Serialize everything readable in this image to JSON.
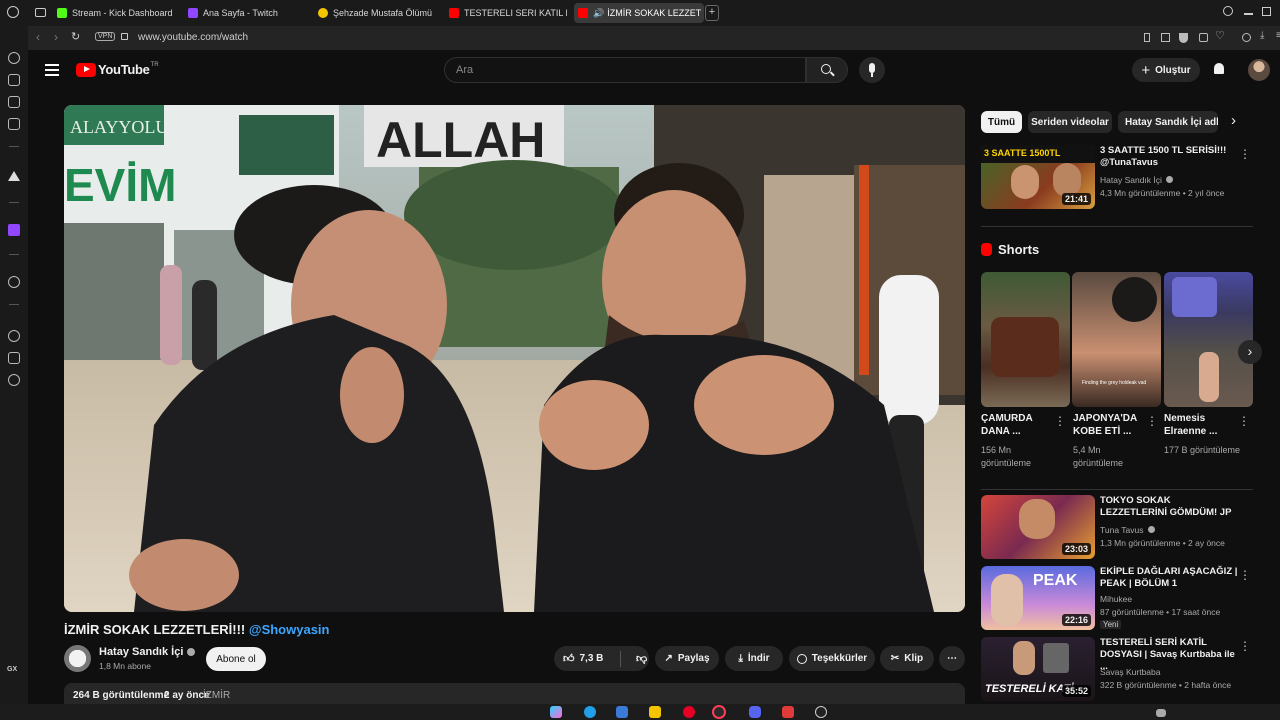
{
  "browser": {
    "tabs": [
      {
        "label": "Stream - Kick Dashboard",
        "color": "#53fc18"
      },
      {
        "label": "Ana Sayfa - Twitch",
        "color": "#9146ff"
      },
      {
        "label": "Şehzade Mustafa Ölümü",
        "color": "#f5c400"
      },
      {
        "label": "TESTERELI SERI KATIL D",
        "color": "#ff0000"
      },
      {
        "label": "İZMİR SOKAK LEZZET",
        "color": "#ff0000"
      }
    ],
    "vpn_label": "VPN",
    "url": "www.youtube.com/watch"
  },
  "header": {
    "logo_text": "YouTube",
    "logo_sup": "TR",
    "search_placeholder": "Ara",
    "create_label": "Oluştur"
  },
  "video": {
    "title": "İZMİR SOKAK LEZZETLERİ!!!",
    "title_tag": "@Showyasin",
    "channel": "Hatay Sandık İçi",
    "subscribers": "1,8 Mn abone",
    "subscribe_label": "Abone ol",
    "likes": "7,3 B",
    "share_label": "Paylaş",
    "download_label": "İndir",
    "thanks_label": "Teşekkürler",
    "clip_label": "Klip",
    "views": "264 B görüntülenme",
    "date": "2 ay önce",
    "location": "İZMİR"
  },
  "chips": [
    "Tümü",
    "Seriden videolar",
    "Hatay Sandık İçi adlı y"
  ],
  "recommended_top": {
    "title": "3 SAATTE 1500 TL SERİSİ!!! @TunaTavus",
    "channel": "Hatay Sandık İçi",
    "meta": "4,3 Mn görüntülenme • 2 yıl önce",
    "duration": "21:41"
  },
  "shorts": {
    "heading": "Shorts",
    "items": [
      {
        "title": "ÇAMURDA DANA ...",
        "views": "156 Mn görüntüleme"
      },
      {
        "title": "JAPONYA'DA KOBE ETİ ...",
        "views": "5,4 Mn görüntüleme"
      },
      {
        "title": "Nemesis Elraenne ...",
        "views": "177 B görüntüleme"
      }
    ]
  },
  "recommended": [
    {
      "title": "TOKYO SOKAK LEZZETLERİNİ GÖMDÜM! JP",
      "channel": "Tuna Tavus",
      "meta": "1,3 Mn görüntülenme • 2 ay önce",
      "duration": "23:03",
      "badge": ""
    },
    {
      "title": "EKİPLE DAĞLARI AŞACAĞIZ | PEAK | BÖLÜM 1",
      "channel": "Mihukee",
      "meta": "87 görüntülenme • 17 saat önce",
      "duration": "22:16",
      "badge": "Yeni"
    },
    {
      "title": "TESTERELİ SERİ KATİL DOSYASI | Savaş Kurtbaba ile ...",
      "channel": "Savaş Kurtbaba",
      "meta": "322 B görüntülenme • 2 hafta önce",
      "duration": "35:52",
      "badge": ""
    }
  ],
  "thumb_text": {
    "top_badge": "3 SAATTE 1500TL",
    "peak": "PEAK",
    "testereli": "TESTERELİ KATİ",
    "short2_caption": "Finding the grey holdeak vad"
  },
  "video_scene": {
    "sign_allah": "ALLAH",
    "sign_evim": "EVİM",
    "sign_yolu": "ALAYYOLU"
  }
}
